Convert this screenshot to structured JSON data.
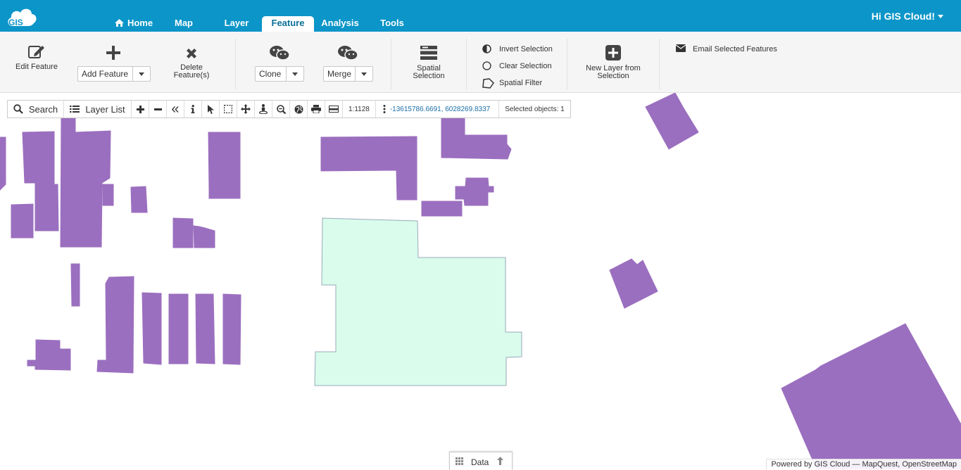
{
  "header": {
    "logo_text": "GIS",
    "tabs": [
      {
        "label": "Home",
        "icon": "home-icon"
      },
      {
        "label": "Map"
      },
      {
        "label": "Layer"
      },
      {
        "label": "Feature",
        "active": true
      },
      {
        "label": "Analysis"
      },
      {
        "label": "Tools"
      }
    ],
    "user_greeting": "Hi GIS Cloud!"
  },
  "ribbon": {
    "edit_feature": "Edit Feature",
    "add_feature": "Add Feature",
    "delete_features": "Delete Feature(s)",
    "clone": "Clone",
    "merge": "Merge",
    "spatial_selection": "Spatial Selection",
    "invert_selection": "Invert Selection",
    "clear_selection": "Clear Selection",
    "spatial_filter": "Spatial Filter",
    "new_layer_from_selection": "New Layer from Selection",
    "email_selected": "Email Selected Features"
  },
  "toolbar": {
    "search_label": "Search",
    "layer_list_label": "Layer List",
    "scale": "1:1128",
    "coordinates": "-13615786.6691, 6028269.8337",
    "selected_objects": "Selected objects: 1",
    "icons": [
      "zoom-in-icon",
      "zoom-out-icon",
      "collapse-icon",
      "info-icon",
      "pointer-icon",
      "box-select-icon",
      "pan-icon",
      "street-view-icon",
      "zoom-box-icon",
      "globe-icon",
      "print-icon",
      "measure-icon"
    ]
  },
  "map": {
    "feature_color": "#9b6fbf",
    "selected_color": "#d9fcec",
    "selected_outline": "#9aaab8"
  },
  "bottom": {
    "data_tab_label": "Data",
    "attribution": "Powered by GIS Cloud — MapQuest, OpenStreetMap"
  },
  "colors": {
    "header_bg": "#0b95c8",
    "ribbon_bg": "#f5f5f5"
  }
}
